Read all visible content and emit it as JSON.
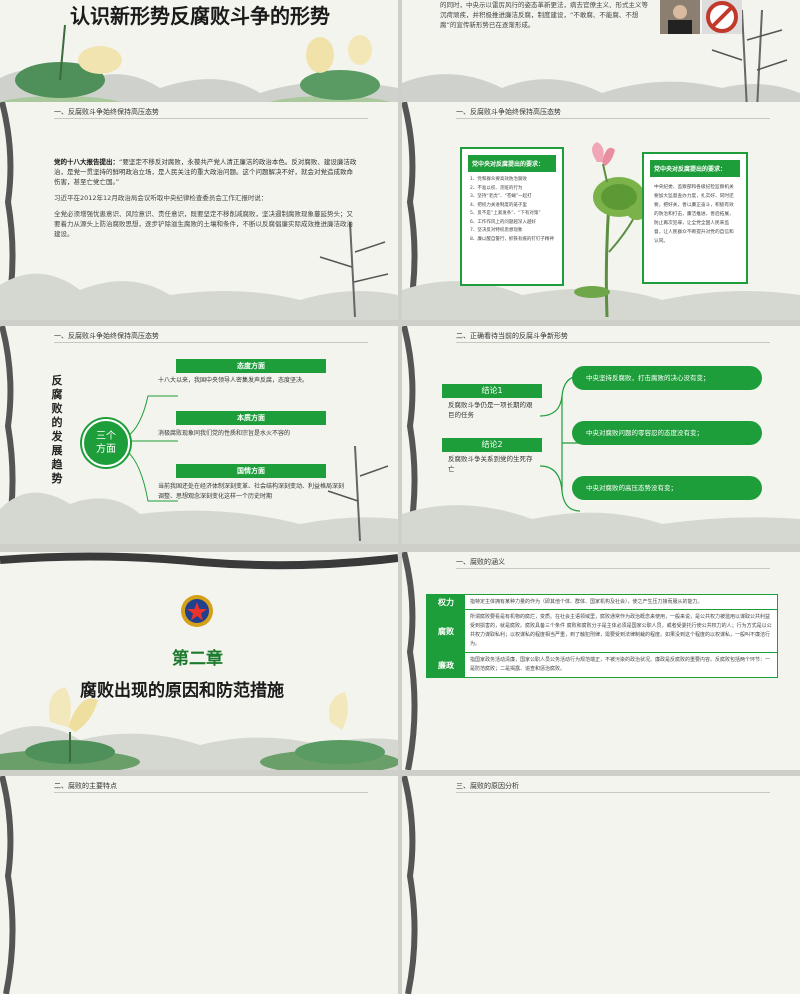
{
  "colors": {
    "green": "#1e9e3a",
    "dark_green": "#0f7a2a",
    "red": "#c0392b",
    "paper": "#f4f4ef"
  },
  "slide1": {
    "title": "认识新形势反腐败斗争的形势"
  },
  "slide2": {
    "text": "的同时，中央示以雷厉风行的姿态革新更法，病去官僚主义、形式主义等沉疴顽疾，并积极推进廉洁反腐，制度建设，“不敢腐、不能腐、不想腐”的宣传新形势已在逐渐形成。"
  },
  "slide3": {
    "header": "一、反腐败斗争始终保持高压态势",
    "lead": "党的十八大报告提出：",
    "p1": "“要坚定不移反对腐败，永葆共产党人清正廉洁的政治本色。反对腐败、建设廉洁政治，是党一贯坚持的鲜明政治立场，是人民关注的重大政治问题。这个问题解决不好，就会对党造成致命伤害，甚至亡党亡国。”",
    "p2": "习近平在2012年12月政治局会议听取中央纪律检查委员会工作汇报时说：",
    "p3": "全党必须增强忧患意识、风险意识、责任意识，既要坚定不移削减腐败，坚决遏制腐败现象蔓延势头；又要着力从源头上防治腐败思想，逐步铲除滋生腐败的土壤和条件，不断以反腐倡廉实际成效推进廉洁政治建设。"
  },
  "slide4": {
    "header": "一、反腐败斗争始终保持高压态势",
    "left_title": "党中央对反腐提出的要求：",
    "left_items": [
      "1、党和群众要高效防治腐败",
      "2、不准以权、贪赃的行为",
      "3、坚持“老虎”、“苍蝇”一起打",
      "4、把权力关进制度的笼子里",
      "5、反不是“上紧发条”、“下有对策”",
      "6、工作作风上的问题越深入越好",
      "7、坚决反对特权思想现象",
      "8、廉以醒自警行，抓铁有痕的钉钉子精神"
    ],
    "right_title": "党中央对反腐提出的要求：",
    "right_text": "中央纪委、监察部和各级纪检监察机关要加大监督查办力度，扎实好、同时还要，把好关，善以廉正奋斗，积极有效的防治和打击，廉洁推进，善后拓展，防止再次犯罪，让全党全国人民来监督，让人民群众不断提升对党的自信和认同。"
  },
  "slide5": {
    "header": "一、反腐败斗争始终保持高压态势",
    "vertical_title": "反腐败的发展趋势",
    "center_label": "三个方面",
    "aspects": [
      {
        "title": "态度方面",
        "text": "十八大以来，我国中央领导人密集发声反腐，态度坚决。"
      },
      {
        "title": "本质方面",
        "text": "消极腐败现象同我们党的性质和宗旨是水火不容的"
      },
      {
        "title": "国情方面",
        "text": "当前我国还处在经济体制深刻变革、社会结构深刻变动、利益格局深刻调整、思想观念深刻变化这样一个历史时期"
      }
    ]
  },
  "slide6": {
    "header": "二、正确看待当前的反腐斗争新形势",
    "conclusions": [
      {
        "title": "结论1",
        "text": "反腐败斗争仍是一项长期的艰巨的任务"
      },
      {
        "title": "结论2",
        "text": "反腐败斗争关系到党的生死存亡"
      }
    ],
    "bars": [
      "中央坚持反腐败，打击腐败的决心没有变；",
      "中央对腐败问题的零容忍的态度没有变；",
      "中央对腐败的高压态势没有变；"
    ]
  },
  "slide7": {
    "chapter": "第二章",
    "title": "腐败出现的原因和防范措施"
  },
  "slide8": {
    "header": "一、腐败的涵义",
    "rows": [
      {
        "label": "权力",
        "text": "指特定主体拥有某种力量的作为（即其他个体、群体、国家机构及社会），使之产生压力接而服从的能力。"
      },
      {
        "label": "腐败",
        "text": "所谓腐败要看是有机物的腐烂，变质。在社会主语领域里，腐败通常作为政治概念来使用，一般来说，是公共权力被滥用以谋取公共利益受到损害的，就是腐败。腐败具备三个条件 腐败和腐败分子是主体必须是国家公职人员，或者受委托行使公共权力的人；行为方式是以公共权力谋取私利；以权谋私的程度相当严重，到了触犯刑律，需要受到法律制裁的程度。如果没到这个程度的以权谋私，一般叫不廉洁行为。"
      },
      {
        "label": "廉政",
        "text": "指国家政务活动清廉，国家公职人员公务活动行为规范端正，不被污染的政治状况。廉政是反腐败的重要内容。反腐败包括两个环节：一是防范腐败；二是揭露、追查和惩治腐败。"
      }
    ]
  },
  "slide9": {
    "header": "二、腐败的主要特点"
  },
  "slide10": {
    "header": "三、腐败的原因分析"
  }
}
